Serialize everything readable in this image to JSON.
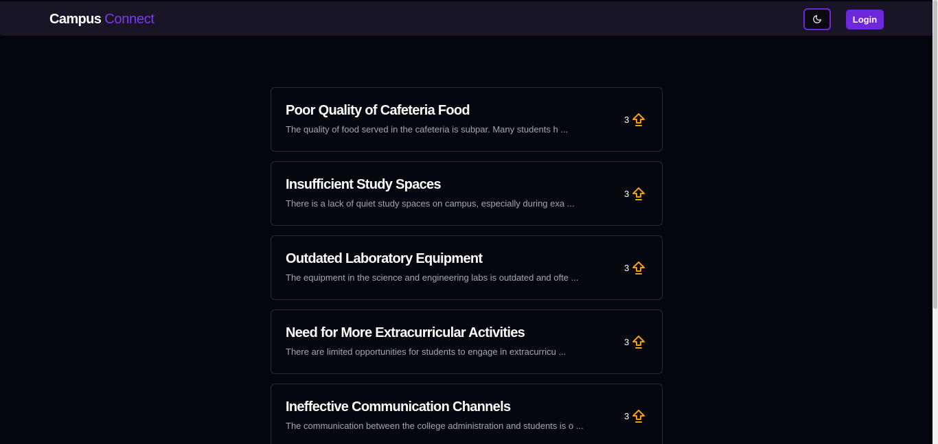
{
  "brand": {
    "part1": "Campus",
    "part2": "Connect"
  },
  "header": {
    "theme_toggle_icon": "moon-icon",
    "login_label": "Login"
  },
  "colors": {
    "background": "#04060d",
    "navbar": "#191527",
    "accent": "#7c3aed",
    "upvote": "#f59e0b"
  },
  "issues": [
    {
      "title": "Poor Quality of Cafeteria Food",
      "description": "The quality of food served in the cafeteria is subpar. Many students h ...",
      "votes": "3"
    },
    {
      "title": "Insufficient Study Spaces",
      "description": "There is a lack of quiet study spaces on campus, especially during exa ...",
      "votes": "3"
    },
    {
      "title": "Outdated Laboratory Equipment",
      "description": "The equipment in the science and engineering labs is outdated and ofte ...",
      "votes": "3"
    },
    {
      "title": "Need for More Extracurricular Activities",
      "description": "There are limited opportunities for students to engage in extracurricu ...",
      "votes": "3"
    },
    {
      "title": "Ineffective Communication Channels",
      "description": "The communication between the college administration and students is o ...",
      "votes": "3"
    }
  ]
}
